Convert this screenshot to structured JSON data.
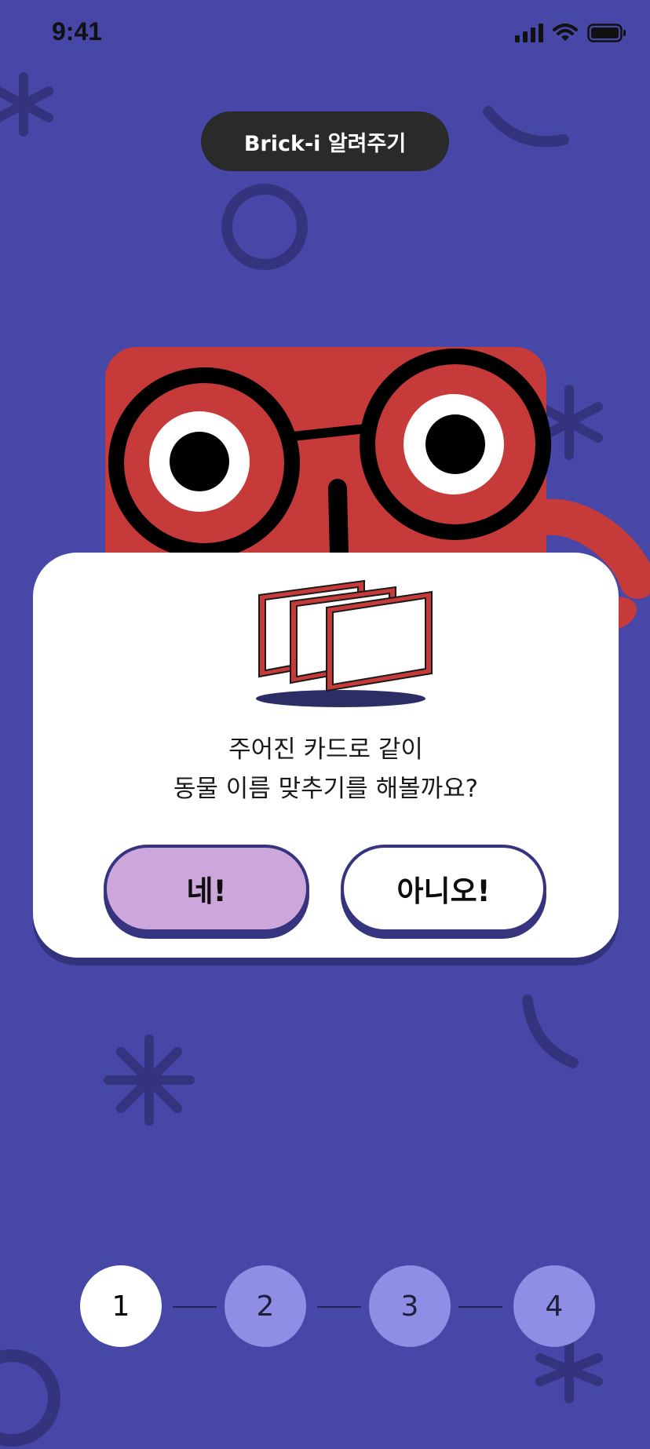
{
  "status_bar": {
    "time": "9:41"
  },
  "header": {
    "title": "Brick-i 알려주기"
  },
  "dialog": {
    "question_line1": "주어진 카드로 같이",
    "question_line2": "동물 이름 맞추기를 해볼까요?",
    "yes_label": "네!",
    "no_label": "아니오!"
  },
  "stepper": {
    "steps": [
      {
        "label": "1",
        "active": true
      },
      {
        "label": "2",
        "active": false
      },
      {
        "label": "3",
        "active": false
      },
      {
        "label": "4",
        "active": false
      }
    ]
  },
  "colors": {
    "background": "#4747A8",
    "mascot_red": "#C63A3A",
    "yes_button": "#CDA7DC",
    "step_active": "#FFFFFF",
    "step_inactive": "#8E8EE4",
    "decoration": "#34347E"
  },
  "icons": [
    "signal-icon",
    "wifi-icon",
    "battery-icon"
  ]
}
